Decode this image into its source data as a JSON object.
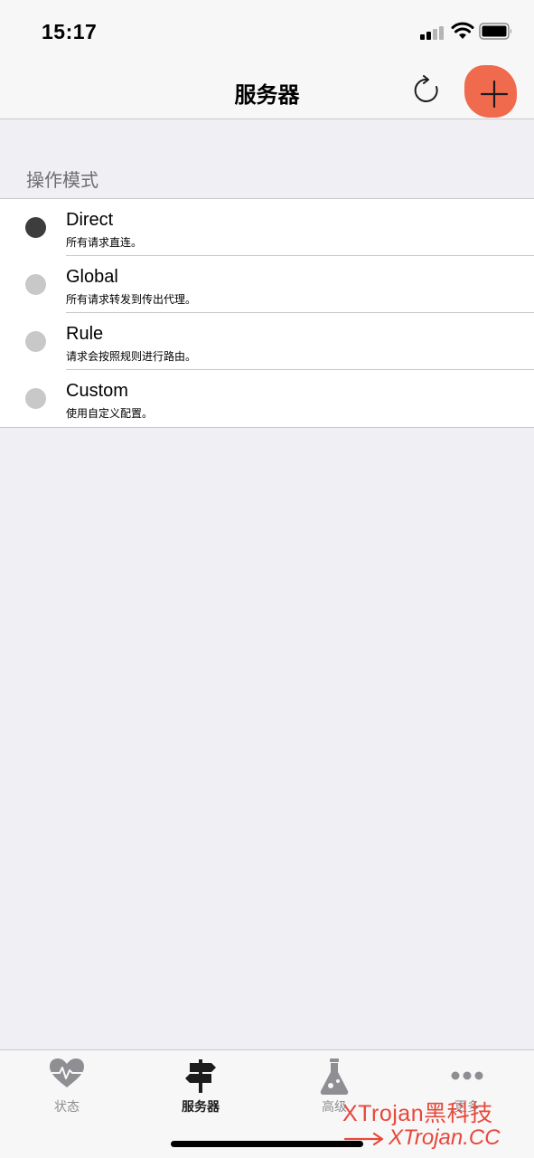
{
  "status_bar": {
    "time": "15:17",
    "icons": [
      "signal-icon",
      "wifi-icon",
      "battery-icon"
    ]
  },
  "nav": {
    "title": "服务器",
    "refresh_icon": "refresh-icon",
    "add_icon": "plus-icon"
  },
  "section": {
    "header": "操作模式",
    "modes": [
      {
        "title": "Direct",
        "description": "所有请求直连。",
        "selected": true
      },
      {
        "title": "Global",
        "description": "所有请求转发到传出代理。",
        "selected": false
      },
      {
        "title": "Rule",
        "description": "请求会按照规则进行路由。",
        "selected": false
      },
      {
        "title": "Custom",
        "description": "使用自定义配置。",
        "selected": false
      }
    ]
  },
  "tabs": [
    {
      "label": "状态",
      "icon": "heart-pulse-icon",
      "active": false
    },
    {
      "label": "服务器",
      "icon": "signpost-icon",
      "active": true
    },
    {
      "label": "高级",
      "icon": "flask-icon",
      "active": false
    },
    {
      "label": "更多",
      "icon": "more-dots-icon",
      "active": false
    }
  ],
  "watermark": {
    "title": "XTrojan黑科技",
    "url": "XTrojan.CC"
  },
  "colors": {
    "background": "#efeff4",
    "bar": "#f7f7f7",
    "selected_radio": "#3d3d3d",
    "unselected_radio": "#c8c8c8",
    "annotation": "#f06a4e",
    "watermark": "#e8473a"
  }
}
